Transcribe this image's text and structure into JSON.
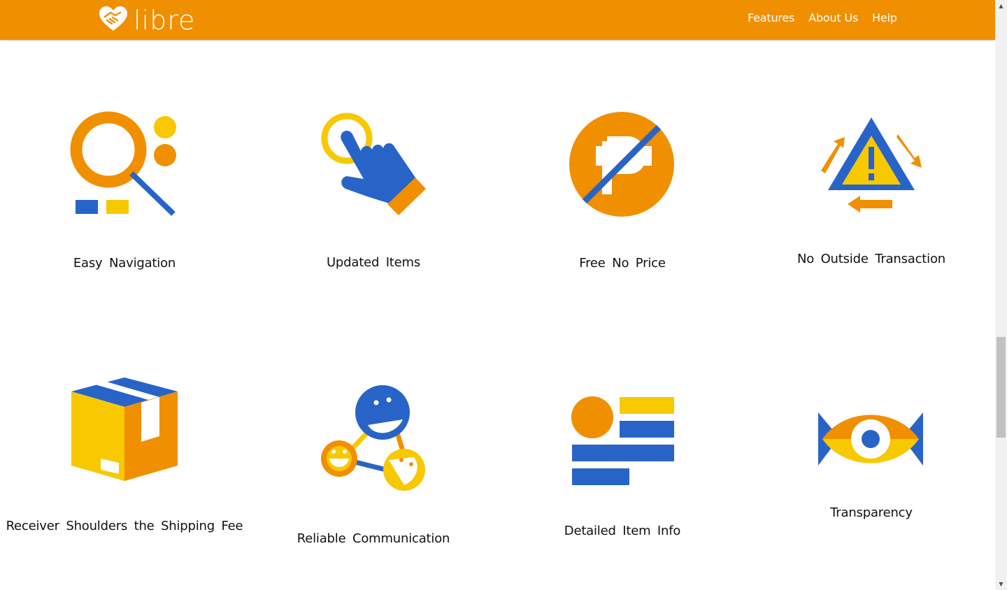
{
  "brand": {
    "name": "libre",
    "primary_color": "#f08f00",
    "blue": "#2864c8",
    "yellow": "#f8c800",
    "icon": "heart-handshake-icon"
  },
  "nav": {
    "items": [
      {
        "label": "Features"
      },
      {
        "label": "About Us"
      },
      {
        "label": "Help"
      }
    ]
  },
  "features": [
    {
      "label": "Easy Navigation",
      "icon": "magnifier-icon"
    },
    {
      "label": "Updated Items",
      "icon": "pointing-hand-icon"
    },
    {
      "label": "Free No Price",
      "icon": "no-peso-icon"
    },
    {
      "label": "No Outside Transaction",
      "icon": "warning-arrows-icon"
    },
    {
      "label": "Receiver Shoulders the Shipping Fee",
      "icon": "package-box-icon"
    },
    {
      "label": "Reliable Communication",
      "icon": "connected-faces-icon"
    },
    {
      "label": "Detailed Item Info",
      "icon": "info-list-icon"
    },
    {
      "label": "Transparency",
      "icon": "eye-icon"
    }
  ]
}
